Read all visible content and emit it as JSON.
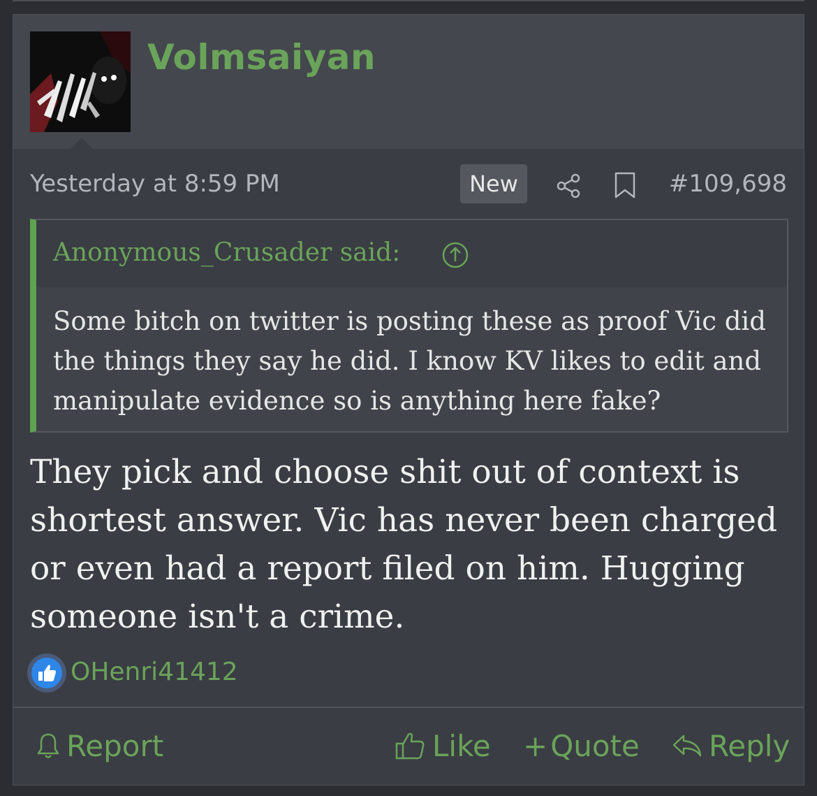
{
  "post": {
    "username": "Volmsaiyan",
    "timestamp": "Yesterday at 8:59 PM",
    "new_badge": "New",
    "post_number": "#109,698",
    "quote": {
      "author": "Anonymous_Crusader said:",
      "text": "Some bitch on twitter is posting these as proof Vic did the things they say he did. I know KV likes to edit and manipulate evidence so is anything here fake?"
    },
    "body": "They pick and choose shit out of context is shortest answer. Vic has never been charged or even had a report filed on him. Hugging someone isn't a crime.",
    "reactions": {
      "type_icon": "like-icon",
      "users": "OHenri41412"
    },
    "actions": {
      "report": "Report",
      "like": "Like",
      "quote": "Quote",
      "quote_prefix": "+",
      "reply": "Reply"
    }
  },
  "colors": {
    "accent": "#6aa35a",
    "background": "#3a3d43",
    "header": "#44474e",
    "quote_bar": "#5fa251"
  }
}
